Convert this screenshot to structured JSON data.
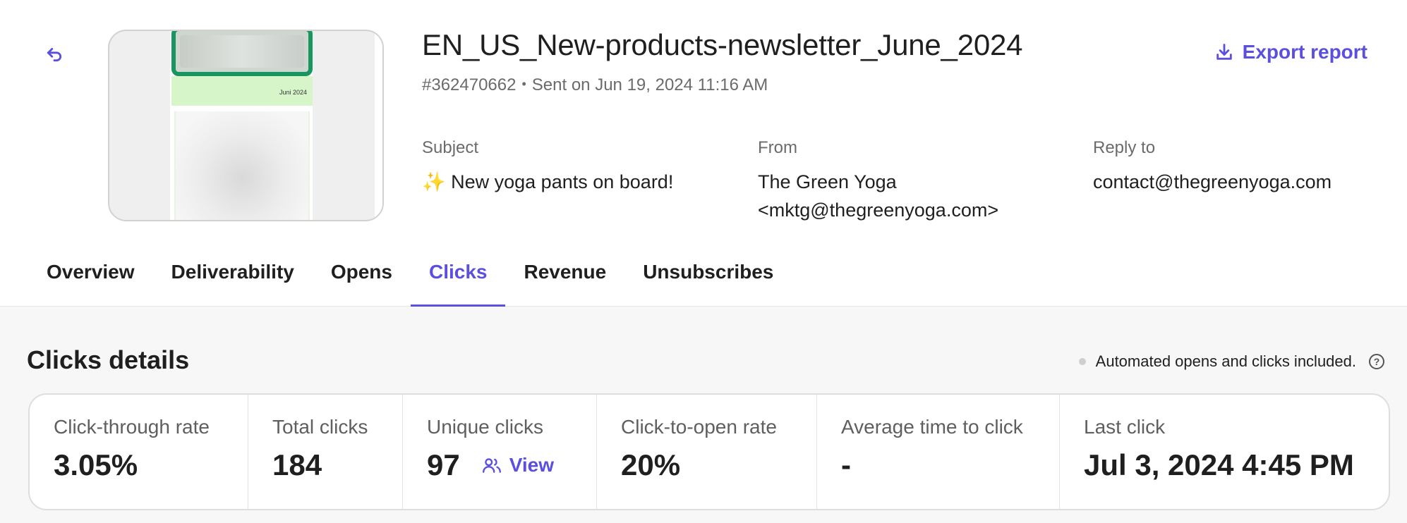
{
  "campaign": {
    "title": "EN_US_New-products-newsletter_June_2024",
    "id": "#362470662",
    "separator": "•",
    "sent": "Sent on Jun 19, 2024 11:16 AM",
    "thumbnail_date": "Juni 2024",
    "export_label": "Export report"
  },
  "fields": {
    "subject_label": "Subject",
    "subject_value": "✨ New yoga pants on board!",
    "from_label": "From",
    "from_name": "The Green Yoga",
    "from_email": "<mktg@thegreenyoga.com>",
    "reply_label": "Reply to",
    "reply_value": "contact@thegreenyoga.com"
  },
  "tabs": [
    {
      "label": "Overview"
    },
    {
      "label": "Deliverability"
    },
    {
      "label": "Opens"
    },
    {
      "label": "Clicks",
      "active": true
    },
    {
      "label": "Revenue"
    },
    {
      "label": "Unsubscribes"
    }
  ],
  "details": {
    "title": "Clicks details",
    "note": "Automated opens and clicks included.",
    "help": "?"
  },
  "stats": [
    {
      "label": "Click-through rate",
      "value": "3.05%"
    },
    {
      "label": "Total clicks",
      "value": "184"
    },
    {
      "label": "Unique clicks",
      "value": "97",
      "link": "View"
    },
    {
      "label": "Click-to-open rate",
      "value": "20%"
    },
    {
      "label": "Average time to click",
      "value": "-"
    },
    {
      "label": "Last click",
      "value": "Jul 3, 2024 4:45 PM"
    }
  ],
  "colors": {
    "accent": "#5b4fe0",
    "thumb_border_green": "#19965f",
    "thumb_band_green": "#d6f5c8"
  }
}
